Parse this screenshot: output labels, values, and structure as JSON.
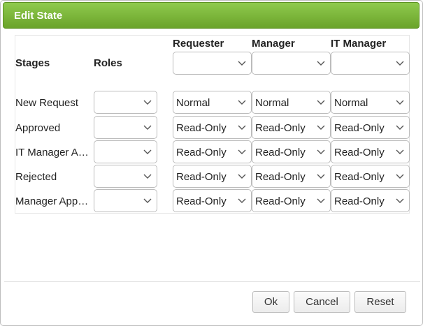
{
  "dialog": {
    "title": "Edit State"
  },
  "headers": {
    "stages": "Stages",
    "roles": "Roles",
    "requester": "Requester",
    "manager": "Manager",
    "it_manager": "IT Manager"
  },
  "header_selects": {
    "requester": "",
    "manager": "",
    "it_manager": ""
  },
  "rows": [
    {
      "stage": "New Request",
      "role": "",
      "requester": "Normal",
      "manager": "Normal",
      "it_manager": "Normal"
    },
    {
      "stage": "Approved",
      "role": "",
      "requester": "Read-Only",
      "manager": "Read-Only",
      "it_manager": "Read-Only"
    },
    {
      "stage": "IT Manager Approved",
      "role": "",
      "requester": "Read-Only",
      "manager": "Read-Only",
      "it_manager": "Read-Only"
    },
    {
      "stage": "Rejected",
      "role": "",
      "requester": "Read-Only",
      "manager": "Read-Only",
      "it_manager": "Read-Only"
    },
    {
      "stage": "Manager Approved",
      "role": "",
      "requester": "Read-Only",
      "manager": "Read-Only",
      "it_manager": "Read-Only"
    }
  ],
  "buttons": {
    "ok": "Ok",
    "cancel": "Cancel",
    "reset": "Reset"
  },
  "icons": {
    "dropdown": "chevron-down-icon"
  },
  "colors": {
    "title_bar": "#7cb83a",
    "title_text": "#ffffff"
  }
}
